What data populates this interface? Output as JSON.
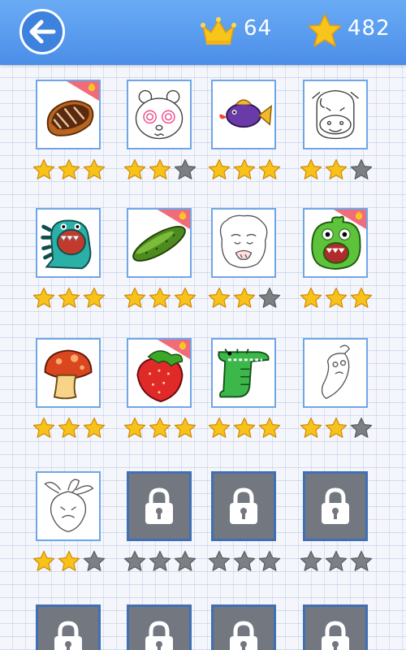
{
  "header": {
    "back_icon": "arrow-left-icon",
    "crown_icon": "crown-icon",
    "crown_count": "64",
    "star_icon": "star-icon",
    "star_count": "482"
  },
  "colors": {
    "header_top": "#6aabf5",
    "header_bottom": "#4b8ee8",
    "tile_border": "#6fa6e6",
    "locked_tile": "#737880",
    "star_gold": "#f7c21a",
    "star_empty": "#7c7f84"
  },
  "levels": [
    {
      "subject": "chocolate-eclair",
      "locked": false,
      "stars": 3,
      "badge": true
    },
    {
      "subject": "panda-face",
      "locked": false,
      "stars": 2,
      "badge": false
    },
    {
      "subject": "purple-fish",
      "locked": false,
      "stars": 3,
      "badge": false
    },
    {
      "subject": "cow-face",
      "locked": false,
      "stars": 2,
      "badge": false
    },
    {
      "subject": "teal-dinosaur",
      "locked": false,
      "stars": 3,
      "badge": false
    },
    {
      "subject": "cucumber",
      "locked": false,
      "stars": 3,
      "badge": true
    },
    {
      "subject": "old-man-face",
      "locked": false,
      "stars": 2,
      "badge": false
    },
    {
      "subject": "green-monster",
      "locked": false,
      "stars": 3,
      "badge": true
    },
    {
      "subject": "mushroom",
      "locked": false,
      "stars": 3,
      "badge": false
    },
    {
      "subject": "strawberry",
      "locked": false,
      "stars": 3,
      "badge": true
    },
    {
      "subject": "crocodile",
      "locked": false,
      "stars": 3,
      "badge": false
    },
    {
      "subject": "chili-pepper",
      "locked": false,
      "stars": 2,
      "badge": false
    },
    {
      "subject": "radish",
      "locked": false,
      "stars": 2,
      "badge": false
    },
    {
      "subject": "locked",
      "locked": true,
      "stars": 0,
      "badge": false
    },
    {
      "subject": "locked",
      "locked": true,
      "stars": 0,
      "badge": false
    },
    {
      "subject": "locked",
      "locked": true,
      "stars": 0,
      "badge": false
    },
    {
      "subject": "locked",
      "locked": true,
      "stars": 0,
      "badge": false
    },
    {
      "subject": "locked",
      "locked": true,
      "stars": 0,
      "badge": false
    },
    {
      "subject": "locked",
      "locked": true,
      "stars": 0,
      "badge": false
    },
    {
      "subject": "locked",
      "locked": true,
      "stars": 0,
      "badge": false
    }
  ]
}
